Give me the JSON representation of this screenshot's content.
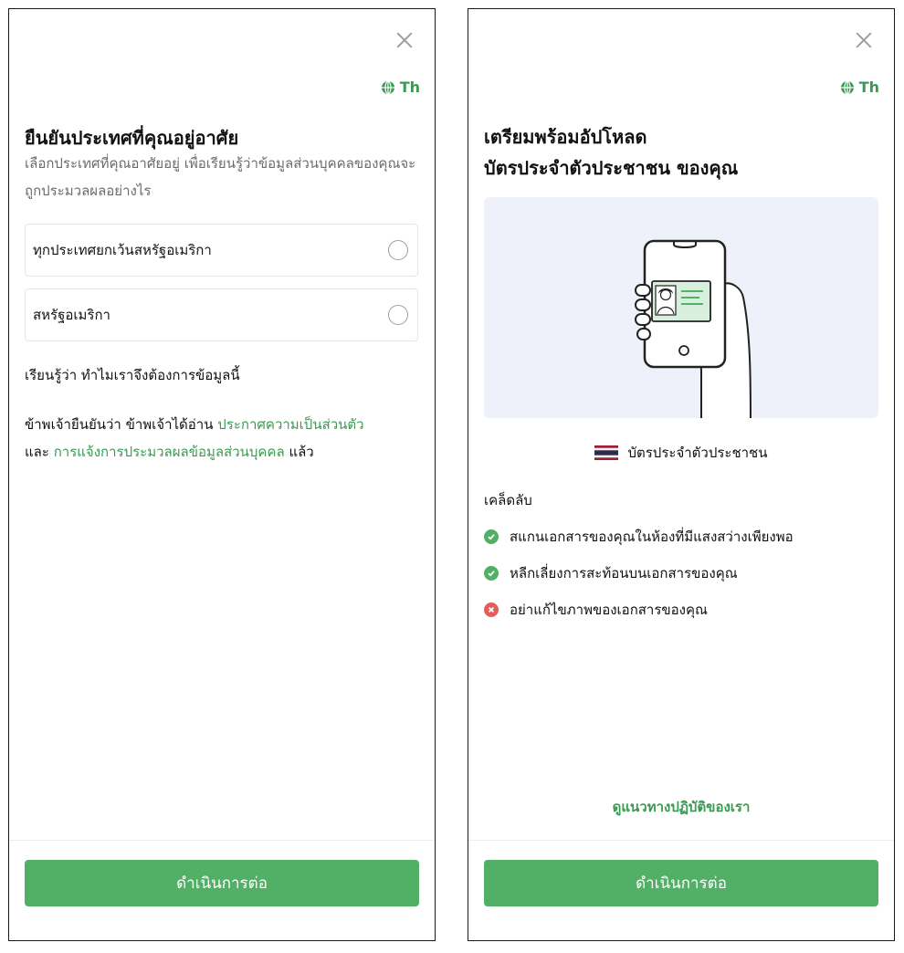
{
  "left_panel": {
    "language": "Th",
    "title": "ยืนยันประเทศที่คุณอยู่อาศัย",
    "subtitle": "เลือกประเทศที่คุณอาศัยอยู่ เพื่อเรียนรู้ว่าข้อมูลส่วนบุคคลของคุณจะถูกประมวลผลอย่างไร",
    "options": [
      "ทุกประเทศยกเว้นสหรัฐอเมริกา",
      "สหรัฐอเมริกา"
    ],
    "learn_link": "เรียนรู้ว่า ทำไมเราจึงต้องการข้อมูลนี้",
    "consent": {
      "prefix": "ข้าพเจ้ายืนยันว่า ข้าพเจ้าได้อ่าน ",
      "privacy_link": "ประกาศความเป็นส่วนตัว",
      "and": "และ ",
      "processing_link": "การแจ้งการประมวลผลข้อมูลส่วนบุคคล",
      "suffix": " แล้ว"
    },
    "continue_button": "ดำเนินการต่อ"
  },
  "right_panel": {
    "language": "Th",
    "title_line1": "เตรียมพร้อมอัปโหลด",
    "title_line2": "บัตรประจำตัวประชาชน ของคุณ",
    "document_type": "บัตรประจำตัวประชาชน",
    "tips_heading": "เคล็ดลับ",
    "tips": [
      {
        "text": "สแกนเอกสารของคุณในห้องที่มีแสงสว่างเพียงพอ",
        "status": "ok"
      },
      {
        "text": "หลีกเลี่ยงการสะท้อนบนเอกสารของคุณ",
        "status": "ok"
      },
      {
        "text": "อย่าแก้ไขภาพของเอกสารของคุณ",
        "status": "bad"
      }
    ],
    "guideline_link": "ดูแนวทางปฏิบัติของเรา",
    "continue_button": "ดำเนินการต่อ"
  },
  "colors": {
    "accent": "#52b066",
    "link": "#3a9a52",
    "error": "#e35d5d",
    "illustration_bg": "#eef1fa"
  }
}
